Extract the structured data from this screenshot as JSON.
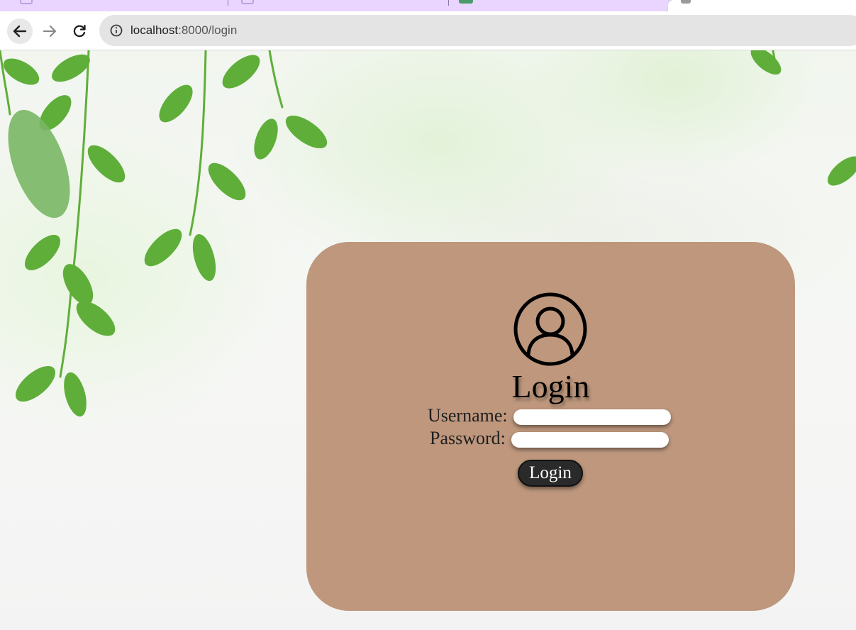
{
  "browser": {
    "url_host": "localhost",
    "url_path": ":8000/login"
  },
  "login_card": {
    "title": "Login",
    "username_label": "Username:",
    "password_label": "Password:",
    "submit_label": "Login",
    "username_value": "",
    "password_value": ""
  },
  "colors": {
    "card": "#be977d",
    "button": "#2a2a2a",
    "tab_strip": "#e9d5ff"
  },
  "icons": [
    "back-arrow-icon",
    "forward-arrow-icon",
    "reload-icon",
    "site-info-icon",
    "user-avatar-icon"
  ]
}
